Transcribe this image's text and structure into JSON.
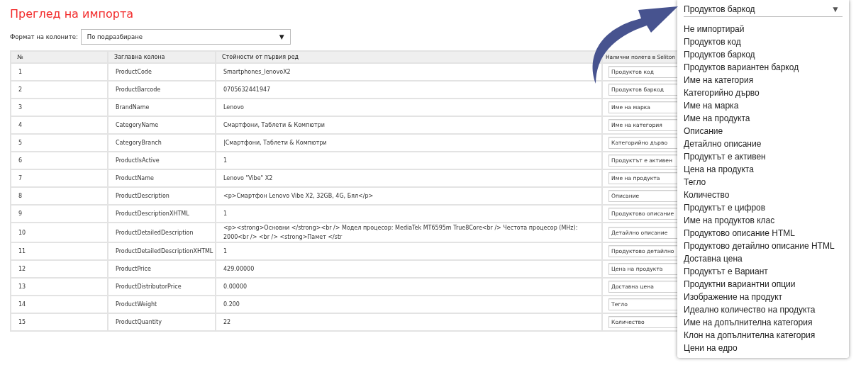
{
  "title": "Преглед на импорта",
  "format": {
    "label": "Формат на колоните:",
    "value": "По подразбиране",
    "caret": "▼"
  },
  "table": {
    "columns": [
      "№",
      "Заглавна колона",
      "Стойности от първия ред",
      "Налични полета в Seliton"
    ],
    "rows": [
      {
        "number": "1",
        "header": "ProductCode",
        "value": "Smartphones_lenovoX2",
        "field": "Продуктов код"
      },
      {
        "number": "2",
        "header": "ProductBarcode",
        "value": "0705632441947",
        "field": "Продуктов баркод"
      },
      {
        "number": "3",
        "header": "BrandName",
        "value": "Lenovo",
        "field": "Име на марка"
      },
      {
        "number": "4",
        "header": "CategoryName",
        "value": "Смартфони, Таблети & Компютри",
        "field": "Име на категория"
      },
      {
        "number": "5",
        "header": "CategoryBranch",
        "value": "|Смартфони, Таблети & Компютри",
        "field": "Категорийно дърво"
      },
      {
        "number": "6",
        "header": "ProductIsActive",
        "value": "1",
        "field": "Продуктът е активен"
      },
      {
        "number": "7",
        "header": "ProductName",
        "value": "Lenovo \"Vibe\" X2",
        "field": "Име на продукта"
      },
      {
        "number": "8",
        "header": "ProductDescription",
        "value": "<p>Смартфон Lenovo Vibe X2, 32GB, 4G, Бял</p>",
        "field": "Описание"
      },
      {
        "number": "9",
        "header": "ProductDescriptionXHTML",
        "value": "1",
        "field": "Продуктово описание"
      },
      {
        "number": "10",
        "header": "ProductDetailedDescription",
        "value": "<p><strong>Основни </strong><br /> Модел процесор: MediaTek MT6595m True8Core<br /> Честота процесор (MHz): 2000<br /> <br /> <strong>Памет </str",
        "field": "Детайлно описание"
      },
      {
        "number": "11",
        "header": "ProductDetailedDescriptionXHTML",
        "value": "1",
        "field": "Продуктово детайлно"
      },
      {
        "number": "12",
        "header": "ProductPrice",
        "value": "429.00000",
        "field": "Цена на продукта"
      },
      {
        "number": "13",
        "header": "ProductDistributorPrice",
        "value": "0.00000",
        "field": "Доставна цена"
      },
      {
        "number": "14",
        "header": "ProductWeight",
        "value": "0.200",
        "field": "Тегло"
      },
      {
        "number": "15",
        "header": "ProductQuantity",
        "value": "22",
        "field": "Количество"
      }
    ]
  },
  "dropdown": {
    "value": "Продуктов баркод",
    "caret": "▼",
    "options": [
      "Не импортирай",
      "Продуктов код",
      "Продуктов баркод",
      "Продуктов вариантен баркод",
      "Име на категория",
      "Категорийно дърво",
      "Име на марка",
      "Име на продукта",
      "Описание",
      "Детайлно описание",
      "Продуктът е активен",
      "Цена на продукта",
      "Тегло",
      "Количество",
      "Продуктът е цифров",
      "Име на продуктов клас",
      "Продуктово описание HTML",
      "Продуктово детайлно описание HTML",
      "Доставна цена",
      "Продуктът е Вариант",
      "Продуктни вариантни опции",
      "Изображение на продукт",
      "Идеално количество на продукта",
      "Име на допълнителна категория",
      "Клон на допълнителна категория",
      "Цени на едро"
    ]
  }
}
